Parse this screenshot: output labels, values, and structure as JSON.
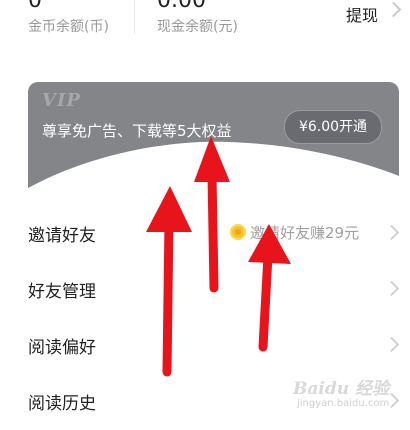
{
  "balances": {
    "coin_value": "0",
    "coin_label": "金币余额(币)",
    "cash_value": "0.00",
    "cash_label": "现金余额(元)"
  },
  "withdraw_label": "提现",
  "vip": {
    "logo": "VIP",
    "benefits": "尊享免广告、下载等5大权益",
    "button_label": "¥6.00开通",
    "colors": {
      "banner": "#838589",
      "button": "#696b70"
    }
  },
  "menu": [
    {
      "label": "邀请好友",
      "promo": "邀请好友赚29元",
      "icon": "coin-icon"
    },
    {
      "label": "好友管理"
    },
    {
      "label": "阅读偏好"
    },
    {
      "label": "阅读历史"
    }
  ],
  "annotation_color": "#e8141c",
  "watermark": {
    "main": "Baidu 经验",
    "url": "jingyan.baidu.com"
  }
}
